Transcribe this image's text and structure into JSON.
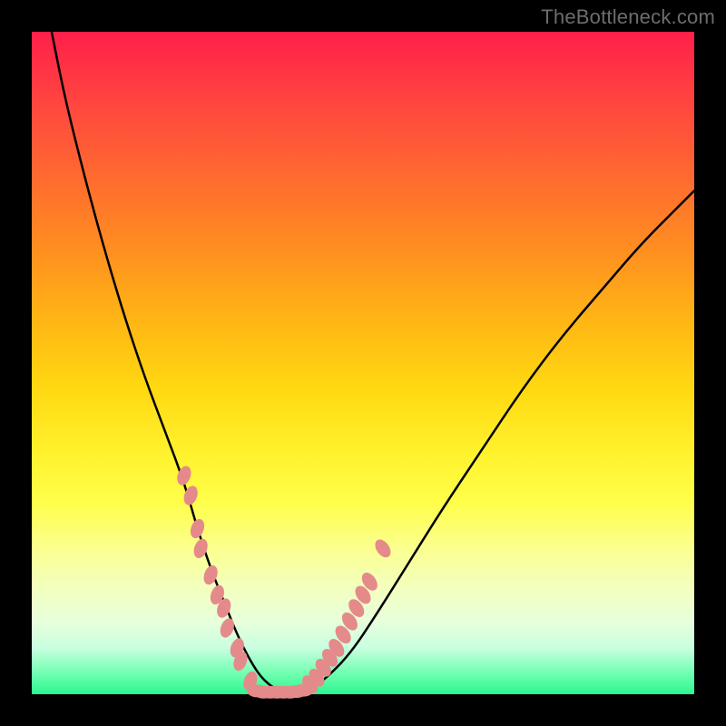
{
  "watermark": {
    "text": "TheBottleneck.com"
  },
  "chart_data": {
    "type": "line",
    "title": "",
    "xlabel": "",
    "ylabel": "",
    "xlim": [
      0,
      100
    ],
    "ylim": [
      0,
      100
    ],
    "grid": false,
    "legend": false,
    "background_gradient": {
      "direction": "vertical",
      "stops": [
        {
          "pos": 0.0,
          "color": "#ff1f4a"
        },
        {
          "pos": 0.5,
          "color": "#ffdd1e"
        },
        {
          "pos": 0.8,
          "color": "#fcff90"
        },
        {
          "pos": 1.0,
          "color": "#2cf58f"
        }
      ]
    },
    "series": [
      {
        "name": "curve",
        "color": "#000000",
        "x": [
          3,
          5,
          8,
          11,
          14,
          17,
          20,
          23,
          25,
          27,
          29,
          31,
          33,
          35,
          38,
          41,
          44,
          48,
          52,
          57,
          62,
          68,
          74,
          80,
          86,
          92,
          98,
          100
        ],
        "y": [
          100,
          90,
          78,
          67,
          57,
          48,
          40,
          32,
          25,
          19,
          14,
          9,
          5,
          2,
          0,
          0,
          2,
          6,
          12,
          20,
          28,
          37,
          46,
          54,
          61,
          68,
          74,
          76
        ]
      },
      {
        "name": "dots-left",
        "type": "scatter",
        "color": "#e58a8a",
        "x": [
          23,
          24,
          25,
          25.5,
          27,
          28,
          29,
          29.5,
          31,
          31.5,
          33
        ],
        "y": [
          33,
          30,
          25,
          22,
          18,
          15,
          13,
          10,
          7,
          5,
          2
        ]
      },
      {
        "name": "dots-bottom",
        "type": "scatter",
        "color": "#e58a8a",
        "x": [
          34,
          35,
          36,
          37,
          38,
          39,
          40,
          41
        ],
        "y": [
          0.5,
          0.3,
          0.3,
          0.3,
          0.3,
          0.3,
          0.4,
          0.6
        ]
      },
      {
        "name": "dots-right",
        "type": "scatter",
        "color": "#e58a8a",
        "x": [
          42,
          43,
          44,
          45,
          46,
          47,
          48,
          49,
          50,
          51,
          53
        ],
        "y": [
          1.5,
          2.5,
          4,
          5.5,
          7,
          9,
          11,
          13,
          15,
          17,
          22
        ]
      }
    ]
  }
}
